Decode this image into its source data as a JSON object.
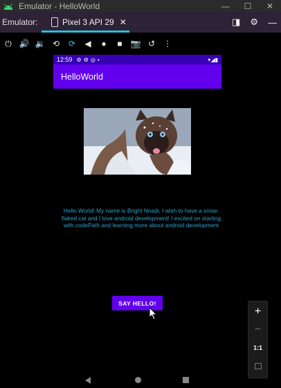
{
  "window": {
    "title": "Emulator - HelloWorld",
    "controls": {
      "minimize": "—",
      "maximize": "☐",
      "close": "✕"
    }
  },
  "tabbar": {
    "label": "Emulator:",
    "device_tab": "Pixel 3 API 29",
    "close_glyph": "✕",
    "right_icons": {
      "window_mode": "◨",
      "settings": "⚙",
      "minimize": "—"
    }
  },
  "toolbar": {
    "icons": [
      "power-icon",
      "volume-up-icon",
      "volume-down-icon",
      "rotate-left-icon",
      "rotate-right-icon",
      "back-icon",
      "home-icon",
      "overview-icon",
      "screenshot-icon",
      "zoom-icon",
      "more-icon"
    ],
    "glyphs": {
      "power": "⏻",
      "vol_up": "🔊",
      "vol_down": "🔉",
      "rot_left": "⟲",
      "rot_right": "⟳",
      "back": "◀",
      "home": "●",
      "overview": "■",
      "camera": "📷",
      "zoom": "↺",
      "more": "⋮"
    }
  },
  "phone": {
    "status": {
      "time": "12:59",
      "left_icons": "⚙⚙◎▪",
      "right_icons": "▾◢▮"
    },
    "app_title": "HelloWorld",
    "image_alt": "snow-flaked-cat",
    "message": "Hello World! My name is Bright Nnadi, I wish to have a snow-flaked cat and I love android development! I excited on starting with codePath and learning more about android development",
    "button_label": "SAY HELLO!"
  },
  "zoom": {
    "plus": "+",
    "minus": "−",
    "one_to_one": "1:1"
  },
  "colors": {
    "status_bar": "#3700b3",
    "app_bar": "#6200ee",
    "button": "#6200ee",
    "message_text": "#2fa0c9",
    "tab_underline": "#27c0d8"
  }
}
